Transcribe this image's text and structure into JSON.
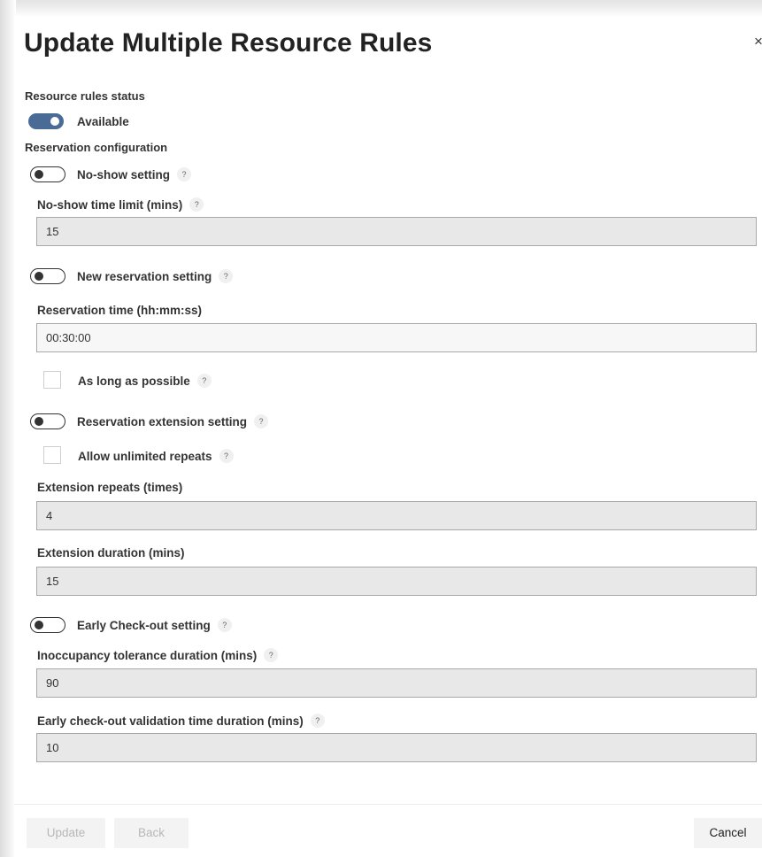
{
  "dialog": {
    "title": "Update Multiple Resource Rules",
    "close_glyph": "×"
  },
  "status": {
    "heading": "Resource rules status",
    "toggle_on": true,
    "toggle_label": "Available"
  },
  "reservation_config": {
    "heading": "Reservation configuration"
  },
  "help_glyph": "?",
  "noshow": {
    "toggle_label": "No-show setting",
    "toggle_on": false,
    "time_limit_label": "No-show time limit (mins)",
    "time_limit_value": "15"
  },
  "new_reservation": {
    "toggle_label": "New reservation setting",
    "toggle_on": false,
    "time_label": "Reservation time (hh:mm:ss)",
    "time_value": "00:30:00",
    "as_long_label": "As long as possible",
    "as_long_checked": false
  },
  "extension": {
    "toggle_label": "Reservation extension setting",
    "toggle_on": false,
    "unlimited_label": "Allow unlimited repeats",
    "unlimited_checked": false,
    "repeats_label": "Extension repeats (times)",
    "repeats_value": "4",
    "duration_label": "Extension duration (mins)",
    "duration_value": "15"
  },
  "early_checkout": {
    "toggle_label": "Early Check-out setting",
    "toggle_on": false,
    "inoccupancy_label": "Inoccupancy tolerance duration (mins)",
    "inoccupancy_value": "90",
    "validation_label": "Early check-out validation time duration (mins)",
    "validation_value": "10"
  },
  "footer": {
    "update_label": "Update",
    "back_label": "Back",
    "cancel_label": "Cancel"
  },
  "colors": {
    "toggle_on": "#4a6b95",
    "field_disabled_bg": "#e8e8e8",
    "button_bg": "#f3f3f3"
  }
}
